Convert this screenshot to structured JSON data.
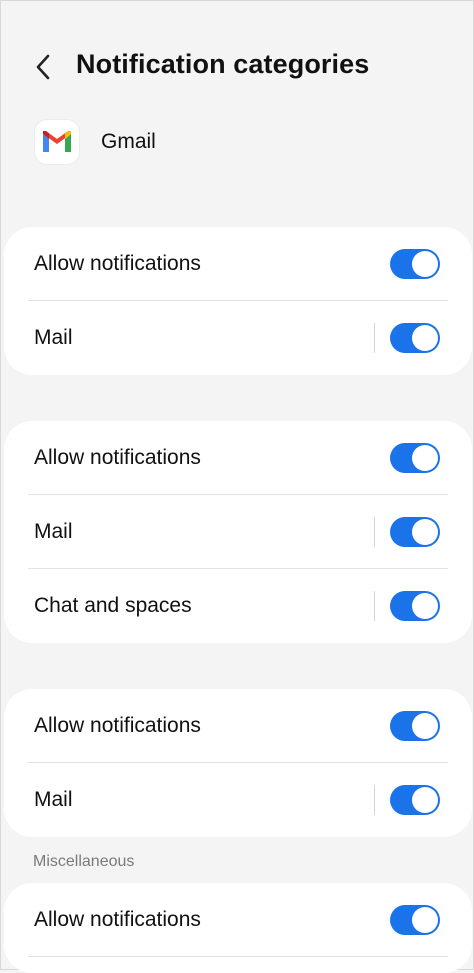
{
  "header": {
    "title": "Notification categories",
    "back_icon": "chevron-left-icon"
  },
  "app": {
    "name": "Gmail",
    "icon": "gmail-logo-icon"
  },
  "groups": [
    {
      "rows": [
        {
          "label": "Allow notifications",
          "on": true
        },
        {
          "label": "Mail",
          "on": true
        }
      ]
    },
    {
      "rows": [
        {
          "label": "Allow notifications",
          "on": true
        },
        {
          "label": "Mail",
          "on": true
        },
        {
          "label": "Chat and spaces",
          "on": true
        }
      ]
    },
    {
      "rows": [
        {
          "label": "Allow notifications",
          "on": true
        },
        {
          "label": "Mail",
          "on": true
        }
      ]
    },
    {
      "section_header": "Miscellaneous",
      "rows": [
        {
          "label": "Allow notifications",
          "on": true
        }
      ]
    }
  ],
  "colors": {
    "toggle_on": "#1a73e8",
    "background": "#f4f4f4",
    "card": "#ffffff"
  }
}
